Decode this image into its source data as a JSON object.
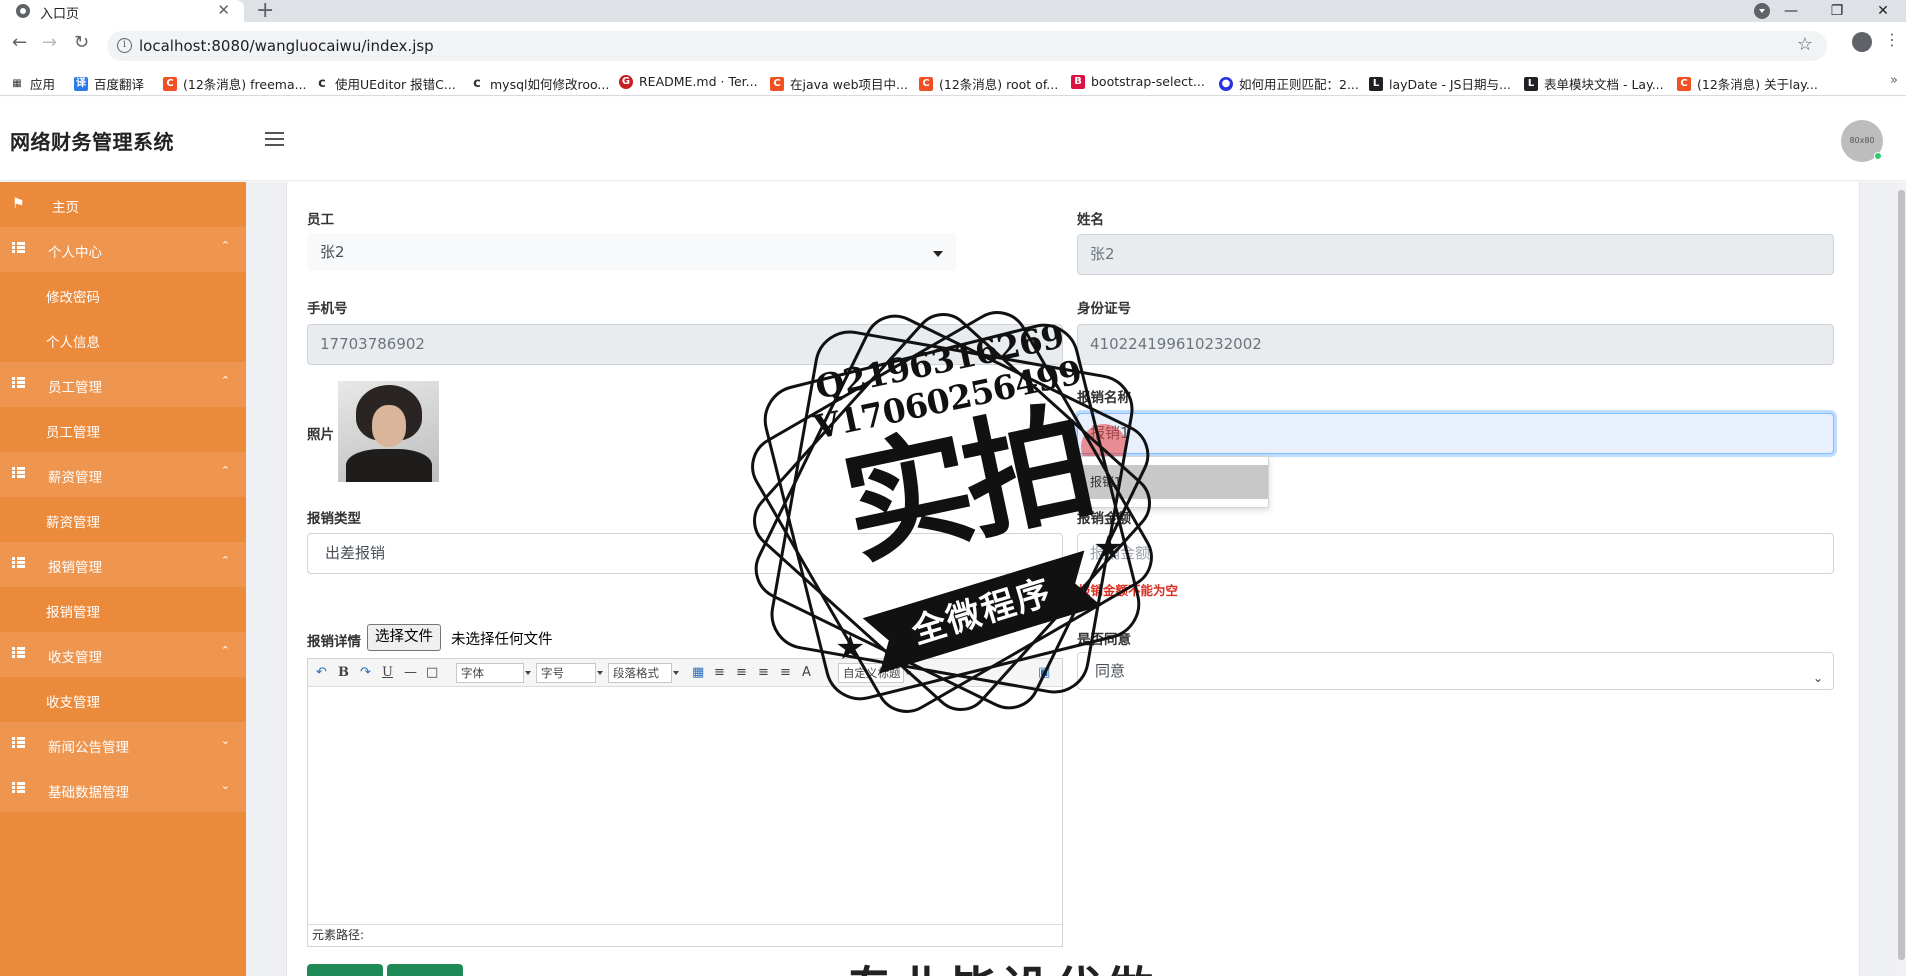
{
  "browser": {
    "tab_title": "入口页",
    "tab_close": "✕",
    "new_tab": "+",
    "url": "localhost:8080/wangluocaiwu/index.jsp",
    "window_controls": [
      "—",
      "❐",
      "✕"
    ],
    "bookmarks": [
      {
        "label": "应用",
        "icon": "apps-grid-icon"
      },
      {
        "label": "百度翻译",
        "icon": "baidu-translate-icon"
      },
      {
        "label": "(12条消息) freema...",
        "icon": "csdn-icon"
      },
      {
        "label": "使用UEditor 报错C...",
        "icon": "ueditor-icon"
      },
      {
        "label": "mysql如何修改roo...",
        "icon": "ueditor-icon"
      },
      {
        "label": "README.md · Ter...",
        "icon": "gitee-icon"
      },
      {
        "label": "在java web项目中...",
        "icon": "csdn-icon"
      },
      {
        "label": "(12条消息) root of...",
        "icon": "csdn-icon"
      },
      {
        "label": "bootstrap-select...",
        "icon": "bootstrap-icon"
      },
      {
        "label": "如何用正则匹配：2...",
        "icon": "baidu-icon"
      },
      {
        "label": "layDate - JS日期与...",
        "icon": "layui-icon"
      },
      {
        "label": "表单模块文档 - Lay...",
        "icon": "layui-icon"
      },
      {
        "label": "(12条消息) 关于lay...",
        "icon": "csdn-icon"
      }
    ],
    "more_bookmarks": "»"
  },
  "header": {
    "brand": "网络财务管理系统",
    "avatar_text": "80x80"
  },
  "sidebar": {
    "items": [
      {
        "label": "主页",
        "type": "home",
        "icon": "flag-icon"
      },
      {
        "label": "个人中心",
        "type": "group",
        "icon": "grid-icon",
        "chevron": "⌃"
      },
      {
        "label": "修改密码",
        "type": "sub"
      },
      {
        "label": "个人信息",
        "type": "sub"
      },
      {
        "label": "员工管理",
        "type": "group",
        "icon": "grid-icon",
        "chevron": "⌃"
      },
      {
        "label": "员工管理",
        "type": "sub"
      },
      {
        "label": "薪资管理",
        "type": "group",
        "icon": "grid-icon",
        "chevron": "⌃"
      },
      {
        "label": "薪资管理",
        "type": "sub"
      },
      {
        "label": "报销管理",
        "type": "group",
        "icon": "grid-icon",
        "chevron": "⌃"
      },
      {
        "label": "报销管理",
        "type": "sub"
      },
      {
        "label": "收支管理",
        "type": "group",
        "icon": "grid-icon",
        "chevron": "⌃"
      },
      {
        "label": "收支管理",
        "type": "sub"
      },
      {
        "label": "新闻公告管理",
        "type": "group",
        "icon": "grid-icon",
        "chevron": "⌄"
      },
      {
        "label": "基础数据管理",
        "type": "group",
        "icon": "grid-icon",
        "chevron": "⌄"
      }
    ]
  },
  "form": {
    "employee_label": "员工",
    "employee_value": "张2",
    "name_label": "姓名",
    "name_value": "张2",
    "phone_label": "手机号",
    "phone_value": "17703786902",
    "idcard_label": "身份证号",
    "idcard_value": "410224199610232002",
    "photo_label": "照片",
    "reimb_name_label": "报销名称",
    "reimb_name_value": "报销1",
    "autocomplete_option": "报销1",
    "reimb_type_label": "报销类型",
    "reimb_type_value": "出差报销",
    "amount_label": "报销金额",
    "amount_placeholder": "报销金额",
    "amount_error": "报销金额不能为空",
    "detail_label": "报销详情",
    "file_button": "选择文件",
    "file_status": "未选择任何文件",
    "agree_label": "是否同意",
    "agree_value": "同意"
  },
  "editor": {
    "font_select": "字体",
    "size_select": "字号",
    "para_select": "段落格式",
    "custom_select": "自定义标题",
    "status_label": "元素路径:"
  },
  "watermark": {
    "line1": "Q2196316269",
    "line2": "V17060256499",
    "big": "实拍",
    "banner": "全微程序",
    "bottom": "专业毕设代做"
  }
}
